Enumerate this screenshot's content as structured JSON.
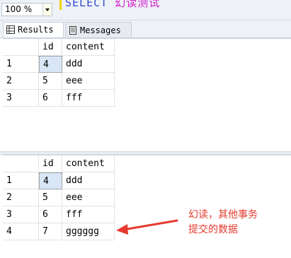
{
  "toolbar": {
    "zoom": "100 %",
    "code_fragment_blue": "SELECT",
    "code_fragment_pink": "幻读测试"
  },
  "tabs": [
    {
      "label": "Results"
    },
    {
      "label": "Messages"
    }
  ],
  "grid1": {
    "columns": [
      "id",
      "content"
    ],
    "rows": [
      {
        "num": "1",
        "id": "4",
        "content": "ddd"
      },
      {
        "num": "2",
        "id": "5",
        "content": "eee"
      },
      {
        "num": "3",
        "id": "6",
        "content": "fff"
      }
    ]
  },
  "grid2": {
    "columns": [
      "id",
      "content"
    ],
    "rows": [
      {
        "num": "1",
        "id": "4",
        "content": "ddd"
      },
      {
        "num": "2",
        "id": "5",
        "content": "eee"
      },
      {
        "num": "3",
        "id": "6",
        "content": "fff"
      },
      {
        "num": "4",
        "id": "7",
        "content": "gggggg"
      }
    ]
  },
  "annotation": {
    "line1": "幻读，其他事务",
    "line2": "提交的数据",
    "color": "#e53a2f"
  }
}
